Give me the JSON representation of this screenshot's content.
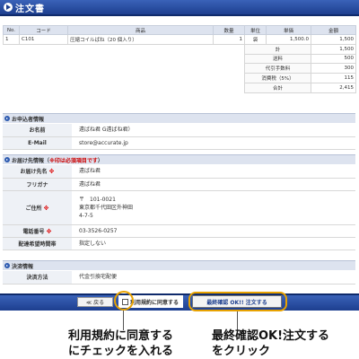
{
  "header": {
    "title": "注文書"
  },
  "order": {
    "columns": [
      "No.",
      "コード",
      "商品",
      "数量",
      "単位",
      "単価",
      "金額"
    ],
    "rows": [
      {
        "no": "1",
        "code": "C101",
        "name": "圧縮コイルばね（20 個入り）",
        "qty": "1",
        "unit": "袋",
        "price": "1,500.0",
        "amount": "1,500"
      }
    ],
    "summary": [
      {
        "label": "計",
        "value": "1,500"
      },
      {
        "label": "送料",
        "value": "500"
      },
      {
        "label": "代引手数料",
        "value": "300"
      },
      {
        "label": "消費税（5%）",
        "value": "115"
      },
      {
        "label": "合計",
        "value": "2,415"
      }
    ]
  },
  "applicant": {
    "heading": "お申込者情報",
    "name_label": "お名前",
    "name_value": "遠ばね君 G遠ばね君）",
    "email_label": "E-Mail",
    "email_value": "store@accurate.jp"
  },
  "delivery": {
    "heading": "お届け先情報（",
    "heading_note": "※印は必須項目です",
    "heading_end": "）",
    "required_mark": "※",
    "name_label": "お届け先名",
    "name_value": "遠ばね君",
    "kana_label": "フリガナ",
    "kana_value": "遠ばね君",
    "address_label": "ご住所",
    "address_zip": "〒　101-0021",
    "address_line1": "東京都千代田区外神田",
    "address_line2": "4-7-5",
    "phone_label": "電話番号",
    "phone_value": "03-3526-0257",
    "time_label": "配達希望時間帯",
    "time_value": "指定しない"
  },
  "payment": {
    "heading": "決済情報",
    "method_label": "決済方法",
    "method_value": "代金引換宅配便"
  },
  "actions": {
    "back_label": "≪ 戻る",
    "agree_label": "利用規約に同意する",
    "confirm_label": "最終確認 OK!! 注文する"
  },
  "annotations": {
    "left_line1": "利用規約に同意する",
    "left_line2": "にチェックを入れる",
    "right_line1": "最終確認OK!注文する",
    "right_line2": "をクリック"
  },
  "colors": {
    "header_blue": "#1d3f8f",
    "highlight": "#e8a200",
    "required_red": "#d00000"
  }
}
